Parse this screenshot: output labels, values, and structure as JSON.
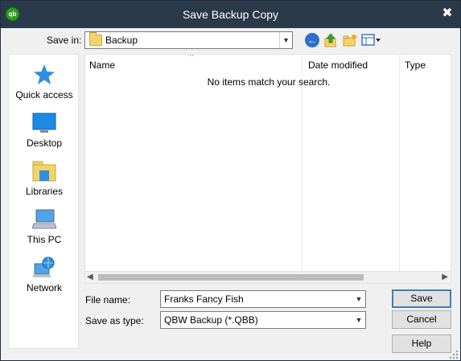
{
  "window": {
    "title": "Save Backup Copy",
    "app_icon_text": "qb",
    "close_glyph": "✖"
  },
  "toolbar": {
    "save_in_label": "Save in:",
    "save_in_value": "Backup",
    "icons": [
      "back-icon",
      "up-folder-icon",
      "new-folder-icon",
      "view-menu-icon"
    ]
  },
  "places": [
    {
      "label": "Quick access",
      "icon": "star-icon"
    },
    {
      "label": "Desktop",
      "icon": "desktop-icon"
    },
    {
      "label": "Libraries",
      "icon": "libraries-icon"
    },
    {
      "label": "This PC",
      "icon": "computer-icon"
    },
    {
      "label": "Network",
      "icon": "network-icon"
    }
  ],
  "filelist": {
    "columns": [
      "Name",
      "Date modified",
      "Type"
    ],
    "empty_message": "No items match your search."
  },
  "form": {
    "file_name_label": "File name:",
    "file_name_value": "Franks Fancy Fish",
    "save_as_type_label": "Save as type:",
    "save_as_type_value": "QBW Backup (*.QBB)"
  },
  "buttons": {
    "save": "Save",
    "cancel": "Cancel",
    "help": "Help"
  },
  "colors": {
    "titlebar": "#2b3a4a",
    "accent": "#3c7fb1",
    "qb_green": "#2ca01c"
  }
}
